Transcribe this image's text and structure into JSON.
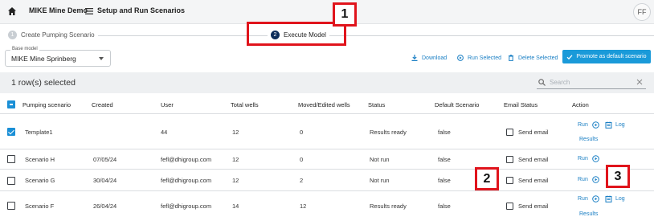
{
  "topbar": {
    "app_title": "MIKE Mine Demo",
    "page_name": "Setup and Run Scenarios",
    "avatar_initials": "FF"
  },
  "stepper": {
    "steps": [
      {
        "number": "1",
        "label": "Create Pumping Scenario"
      },
      {
        "number": "2",
        "label": "Execute Model"
      }
    ]
  },
  "base_model": {
    "label": "Base model",
    "value": "MIKE Mine Sprinberg"
  },
  "toolbar": {
    "download": "Download",
    "run_selected": "Run Selected",
    "delete_selected": "Delete Selected",
    "promote": "Promote as default scenario"
  },
  "selection": {
    "count_text": "1 row(s) selected",
    "search_placeholder": "Search"
  },
  "table": {
    "headers": [
      "Pumping scenario",
      "Created",
      "User",
      "Total wells",
      "Moved/Edited wells",
      "Status",
      "Default Scenario",
      "Email Status",
      "Action"
    ],
    "rows": [
      {
        "name": "Template1",
        "created": "",
        "user": "44",
        "total_wells": "12",
        "moved_wells": "0",
        "status": "Results ready",
        "default": "false",
        "email": "Send email",
        "checked": true,
        "actions": [
          "Run",
          "Log",
          "Results"
        ]
      },
      {
        "name": "Scenario H",
        "created": "07/05/24",
        "user": "fefl@dhigroup.com",
        "total_wells": "12",
        "moved_wells": "0",
        "status": "Not run",
        "default": "false",
        "email": "Send email",
        "checked": false,
        "actions": [
          "Run"
        ]
      },
      {
        "name": "Scenario G",
        "created": "30/04/24",
        "user": "fefl@dhigroup.com",
        "total_wells": "12",
        "moved_wells": "2",
        "status": "Not run",
        "default": "false",
        "email": "Send email",
        "checked": false,
        "actions": [
          "Run"
        ]
      },
      {
        "name": "Scenario F",
        "created": "26/04/24",
        "user": "fefl@dhigroup.com",
        "total_wells": "14",
        "moved_wells": "12",
        "status": "Results ready",
        "default": "false",
        "email": "Send email",
        "checked": false,
        "actions": [
          "Run",
          "Log",
          "Results"
        ]
      }
    ]
  },
  "callouts": [
    "1",
    "2",
    "3"
  ],
  "colors": {
    "accent": "#1a9ad9",
    "link": "#1a7fc4",
    "callout": "#e0141c",
    "step_active": "#0d2d5a"
  }
}
